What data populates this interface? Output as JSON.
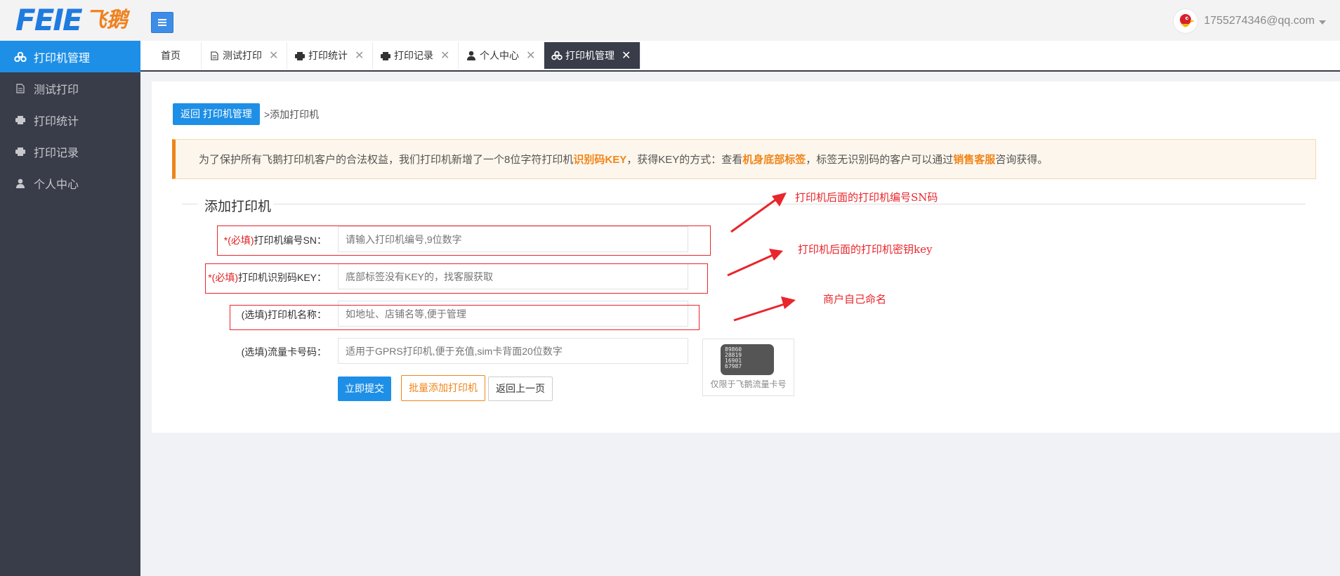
{
  "app": {
    "logo_en": "FEIE",
    "logo_cn": "飞鹅",
    "user_email": "1755274346@qq.com"
  },
  "sidebar": {
    "items": [
      {
        "label": "打印机管理",
        "icon": "cluster-icon",
        "active": true
      },
      {
        "label": "测试打印",
        "icon": "document-icon",
        "active": false
      },
      {
        "label": "打印统计",
        "icon": "printer-icon",
        "active": false
      },
      {
        "label": "打印记录",
        "icon": "printer-icon",
        "active": false
      },
      {
        "label": "个人中心",
        "icon": "user-icon",
        "active": false
      }
    ]
  },
  "tabs": [
    {
      "label": "首页",
      "closable": false
    },
    {
      "label": "测试打印",
      "icon": "document-icon",
      "closable": true
    },
    {
      "label": "打印统计",
      "icon": "printer-icon",
      "closable": true
    },
    {
      "label": "打印记录",
      "icon": "printer-icon",
      "closable": true
    },
    {
      "label": "个人中心",
      "icon": "user-icon",
      "closable": true
    },
    {
      "label": "打印机管理",
      "icon": "cluster-icon",
      "closable": true,
      "active": true
    }
  ],
  "page": {
    "back_button": "返回 打印机管理",
    "breadcrumb": ">添加打印机",
    "notice": {
      "part1": "为了保护所有飞鹅打印机客户的合法权益，我们打印机新增了一个8位字符打印机",
      "highlight1": "识别码KEY",
      "part2": "，获得KEY的方式：查看",
      "highlight2": "机身底部标签",
      "part3": "，标签无识别码的客户可以通过",
      "highlight3": "销售客服",
      "part4": "咨询获得。"
    },
    "section_title": "添加打印机"
  },
  "form": {
    "sn": {
      "required": "*(必填)",
      "label": "打印机编号SN：",
      "placeholder": "请输入打印机编号,9位数字"
    },
    "key": {
      "required": "*(必填)",
      "label": "打印机识别码KEY：",
      "placeholder": "底部标签没有KEY的，找客服获取"
    },
    "name": {
      "label": "(选填)打印机名称：",
      "placeholder": "如地址、店铺名等,便于管理"
    },
    "card": {
      "label": "(选填)流量卡号码：",
      "placeholder": "适用于GPRS打印机,便于充值,sim卡背面20位数字"
    },
    "sim_number": "89860\n28819\n16901\n67987",
    "sim_note": "仅限于飞鹅流量卡号",
    "submit": "立即提交",
    "batch": "批量添加打印机",
    "back": "返回上一页"
  },
  "annotations": {
    "sn": "打印机后面的打印机编号SN码",
    "key": "打印机后面的打印机密钥key",
    "name": "商户自己命名"
  },
  "colors": {
    "primary": "#1e8fe6",
    "sidebar_bg": "#393d49",
    "accent_orange": "#f08519",
    "annotation_red": "#e8262b"
  }
}
